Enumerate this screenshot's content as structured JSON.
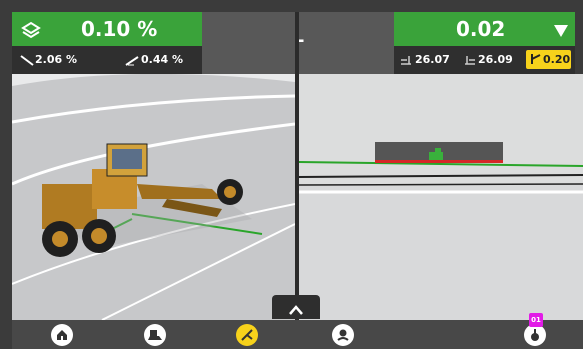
{
  "top_left": {
    "main_value": "0.10 %",
    "cross_slope": "2.06 %",
    "main_slope": "0.44 %"
  },
  "top_mid": {
    "label": "-"
  },
  "top_right": {
    "main_value": "0.02",
    "left_elev": "26.07",
    "right_elev": "26.09",
    "offset_badge": "0.20"
  },
  "bottom_nav": {
    "items": [
      {
        "icon": "home-icon"
      },
      {
        "icon": "machine-icon"
      },
      {
        "icon": "tools-icon"
      },
      {
        "icon": "location-icon"
      },
      {
        "icon": "measure-icon"
      }
    ],
    "badge": "01"
  },
  "colors": {
    "green": "#3aa33a",
    "accent_yellow": "#f7d21b",
    "badge_magenta": "#e21be7"
  }
}
